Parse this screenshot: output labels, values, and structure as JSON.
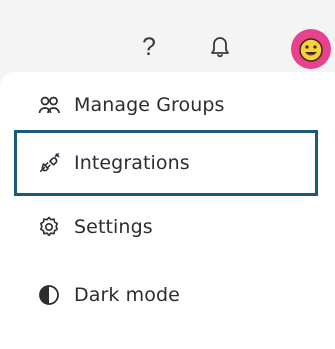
{
  "topbar": {
    "help_label": "?",
    "icons": {
      "help": "question-mark-icon",
      "notifications": "bell-icon",
      "avatar": "smiley-avatar"
    },
    "avatar_color": "#e8418e"
  },
  "menu": {
    "items": [
      {
        "label": "Manage Groups",
        "icon": "users-icon"
      },
      {
        "label": "Integrations",
        "icon": "plug-icon",
        "focused": true
      },
      {
        "label": "Settings",
        "icon": "gear-icon"
      },
      {
        "label": "Dark mode",
        "icon": "contrast-icon"
      }
    ],
    "focus_color": "#185a78"
  }
}
